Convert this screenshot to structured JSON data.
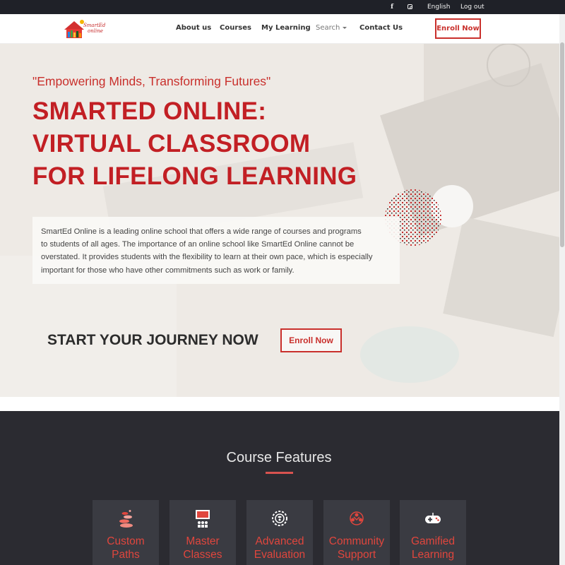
{
  "topbar": {
    "facebook_icon": "facebook-icon",
    "instagram_icon": "instagram-icon",
    "language": "English",
    "logout": "Log out"
  },
  "navbar": {
    "logo_text_line1": "SmartEd",
    "logo_text_line2": "online",
    "links": {
      "about": "About us",
      "courses": "Courses",
      "my_learning": "My Learning",
      "search": "Search",
      "contact": "Contact Us"
    },
    "enroll": "Enroll Now"
  },
  "hero": {
    "tagline": "\"Empowering Minds, Transforming Futures\"",
    "headline": {
      "line1": "SMARTED ONLINE:",
      "line2": "VIRTUAL CLASSROOM",
      "line3": "FOR LIFELONG LEARNING"
    },
    "description": {
      "line1": "SmartEd Online is a leading online school that offers a wide range of courses and programs",
      "line2": "to students of all ages. The importance of an online school like SmartEd Online cannot be",
      "line3": "overstated. It provides students with the flexibility to learn at their own pace, which is especially",
      "line4": "important for those who have other commitments such as work or family."
    },
    "cta_text": "START YOUR JOURNEY NOW",
    "cta_button": "Enroll Now"
  },
  "features": {
    "title": "Course Features",
    "cards": [
      {
        "line1": "Custom",
        "line2": "Paths",
        "icon": "stones-icon"
      },
      {
        "line1": "Master",
        "line2": "Classes",
        "icon": "classroom-icon"
      },
      {
        "line1": "Advanced",
        "line2": "Evaluation",
        "icon": "brain-gear-icon"
      },
      {
        "line1": "Community",
        "line2": "Support",
        "icon": "community-icon"
      },
      {
        "line1": "Gamified",
        "line2": "Learning",
        "icon": "gamepad-icon"
      }
    ]
  },
  "colors": {
    "accent": "#c9302c",
    "topbar_bg": "#1f2128",
    "features_bg": "#2b2b31",
    "card_bg": "#3a3b42"
  }
}
